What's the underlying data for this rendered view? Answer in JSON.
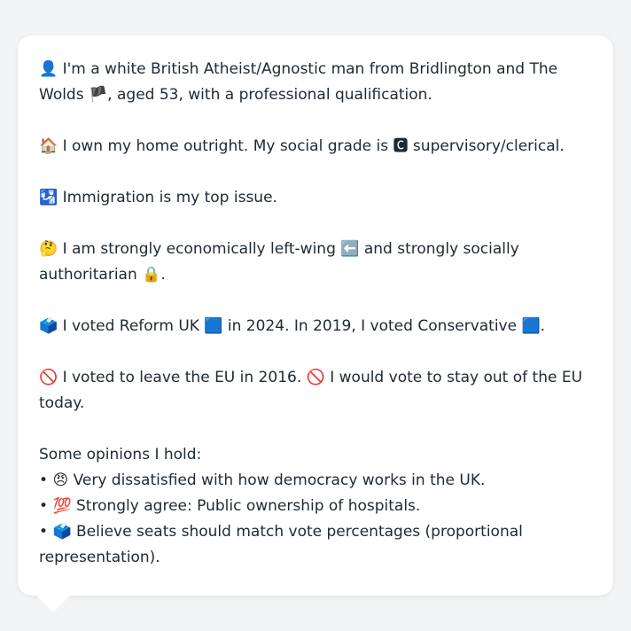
{
  "profile": {
    "identity": {
      "icon": "👤",
      "text_before_flag": " I'm a white British Atheist/Agnostic man from Bridlington and The Wolds ",
      "flag": "🏴",
      "text_after_flag": ", aged 53, with a professional qualification."
    },
    "home": {
      "icon": "🏠",
      "text_before_badge": " I own my home outright. My social grade is ",
      "badge": "🅲",
      "text_after_badge": " supervisory/clerical."
    },
    "top_issue": {
      "icon": "🛂",
      "text": " Immigration is my top issue."
    },
    "ideology": {
      "icon": "🤔",
      "text_before_left": " I am strongly economically left-wing ",
      "left_icon": "⬅️",
      "text_middle": " and strongly socially authoritarian ",
      "lock_icon": "🔒",
      "text_end": "."
    },
    "votes": {
      "icon": "🗳️",
      "text_2024": " I voted Reform UK ",
      "reform_square": "🟦",
      "text_2019": " in 2024. In 2019, I voted Conservative ",
      "conservative_square": "🟦",
      "text_end": "."
    },
    "eu": {
      "icon1": "🚫",
      "text1": " I voted to leave the EU in 2016. ",
      "icon2": "🚫",
      "text2": " I would vote to stay out of the EU today."
    },
    "opinions_heading": "Some opinions I hold:",
    "opinions": [
      {
        "bullet": "• ",
        "icon": "😠",
        "text": " Very dissatisfied with how democracy works in the UK."
      },
      {
        "bullet": "• ",
        "icon": "💯",
        "text": " Strongly agree: Public ownership of hospitals."
      },
      {
        "bullet": "• ",
        "icon": "🗳️",
        "text": " Believe seats should match vote percentages (proportional representation)."
      }
    ]
  }
}
